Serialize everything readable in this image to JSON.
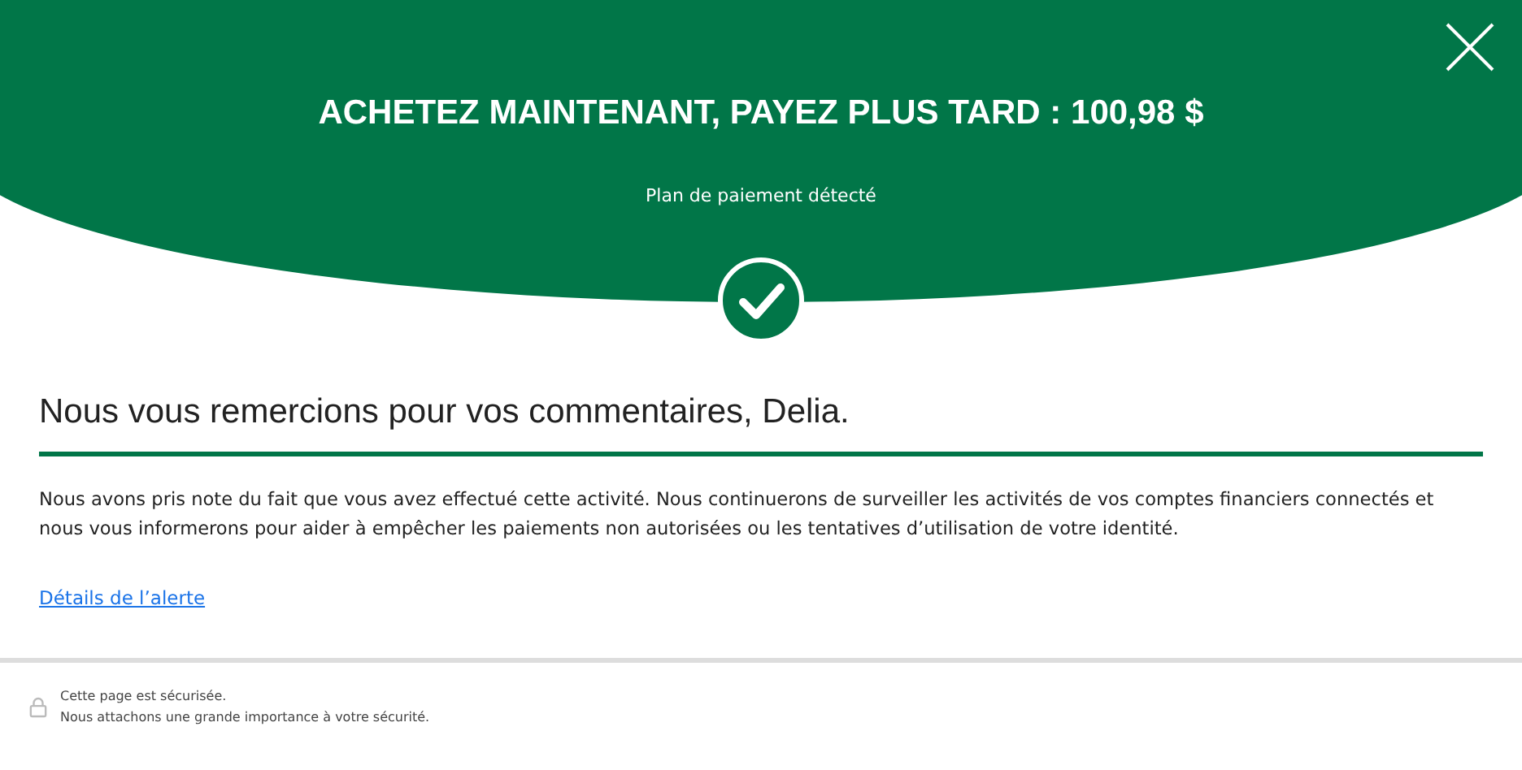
{
  "header": {
    "title": "ACHETEZ MAINTENANT, PAYEZ PLUS TARD : 100,98 $",
    "subtitle": "Plan de paiement détecté"
  },
  "heading": "Nous vous remercions pour vos commentaires, Delia.",
  "message": "Nous avons pris note du fait que vous avez effectué cette activité. Nous continuerons de surveiller les activités de vos comptes financiers connectés et nous vous informerons pour aider à empêcher les paiements non autorisées ou les tentatives d’utilisation de votre identité.",
  "link": "Détails de l’alerte",
  "footer": {
    "lines": [
      "Cette page est sécurisée.",
      "Nous attachons une grande importance à votre sécurité."
    ]
  }
}
